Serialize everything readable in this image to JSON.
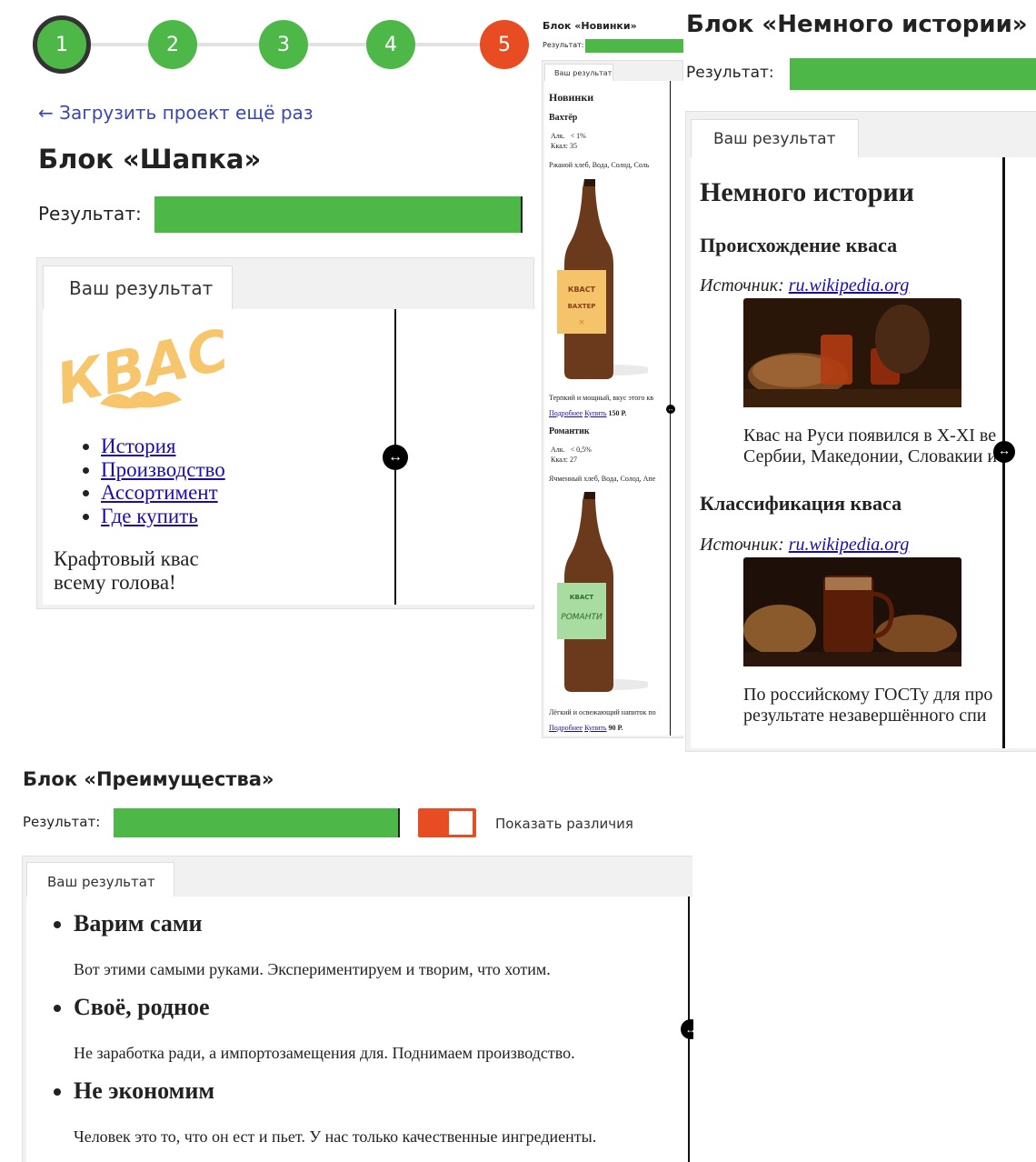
{
  "steps": [
    "1",
    "2",
    "3",
    "4",
    "5"
  ],
  "reload_link": "← Загрузить проект ещё раз",
  "result_label": "Результат:",
  "your_result_tab": "Ваш результат",
  "header_block": {
    "title": "Блок «Шапка»",
    "logo_text": "КВАСТ",
    "nav": [
      "История",
      "Производство",
      "Ассортимент",
      "Где купить"
    ],
    "tagline_1": "Крафтовый квас",
    "tagline_2": "всему голова!"
  },
  "news_block": {
    "title": "Блок «Новинки»",
    "heading": "Новинки",
    "products": [
      {
        "name": "Вахтёр",
        "alc": "Алк.   < 1%",
        "kcal": "Ккал: 35",
        "ingredients": "Ржаной хлеб, Вода, Солод, Соль",
        "label": "ВАХТЕР",
        "desc": "Терпкий и мощный, вкус этого кв",
        "more": "Подробнее",
        "buy": "Купить",
        "price": "150 Р."
      },
      {
        "name": "Романтик",
        "alc": "Алк.   < 0,5%",
        "kcal": "Ккал: 27",
        "ingredients": "Ячменный хлеб, Вода, Солод, Апе",
        "label": "РОМАНТИ",
        "desc": "Лёгкий и освежающий напиток по",
        "more": "Подробнее",
        "buy": "Купить",
        "price": "90 Р."
      }
    ]
  },
  "history_block": {
    "title": "Блок «Немного истории»",
    "heading": "Немного истории",
    "sections": [
      {
        "subheading": "Происхождение кваса",
        "source_label": "Источник:",
        "source_link": "ru.wikipedia.org",
        "text_1": "Квас на Руси появился в X-XI ве",
        "text_2": "Сербии, Македонии, Словакии и"
      },
      {
        "subheading": "Классификация кваса",
        "source_label": "Источник:",
        "source_link": "ru.wikipedia.org",
        "text_1": "По российскому ГОСТу для про",
        "text_2": "результате незавершённого спи"
      }
    ]
  },
  "advantages_block": {
    "title": "Блок «Преимущества»",
    "show_diff_label": "Показать различия",
    "items": [
      {
        "heading": "Варим сами",
        "text": "Вот этими самыми руками. Экспериментируем и творим, что хотим."
      },
      {
        "heading": "Своё, родное",
        "text": "Не заработка ради, а импортозамещения для. Поднимаем производство."
      },
      {
        "heading": "Не экономим",
        "text": "Человек это то, что он ест и пьет. У нас только качественные ингредиенты."
      }
    ]
  },
  "colors": {
    "green": "#4db848",
    "red": "#e84c22",
    "link": "#1a0dab",
    "accent_link": "#3b48a8",
    "logo": "#f7c56c"
  }
}
